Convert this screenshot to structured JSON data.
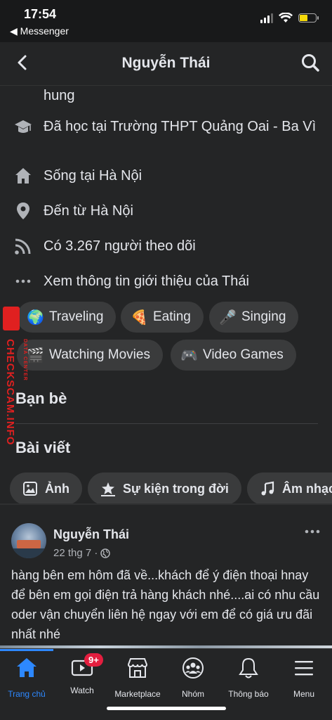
{
  "status_bar": {
    "time": "17:54",
    "back_app": "◀ Messenger"
  },
  "header": {
    "title": "Nguyễn Thái"
  },
  "intro": {
    "partial_line": "hung",
    "studied_prefix": "Đã học tại ",
    "studied_place": "Trường THPT Quảng Oai - Ba Vì",
    "lives_prefix": "Sống tại ",
    "lives_place": "Hà Nội",
    "from_prefix": "Đến từ ",
    "from_place": "Hà Nội",
    "followers": "Có 3.267 người theo dõi",
    "see_about": "Xem thông tin giới thiệu của Thái"
  },
  "hobbies": [
    {
      "label": "Traveling",
      "emoji": "🌍"
    },
    {
      "label": "Eating",
      "emoji": "🍕"
    },
    {
      "label": "Singing",
      "emoji": "🎤"
    },
    {
      "label": "Watching Movies",
      "emoji": "🎬"
    },
    {
      "label": "Video Games",
      "emoji": "🎮"
    }
  ],
  "sections": {
    "friends": "Bạn bè",
    "posts": "Bài viết"
  },
  "post_filters": [
    {
      "label": "Ảnh",
      "icon": "photo-icon"
    },
    {
      "label": "Sự kiện trong đời",
      "icon": "star-flag-icon"
    },
    {
      "label": "Âm nhạc",
      "icon": "music-note-icon"
    }
  ],
  "post": {
    "author": "Nguyễn Thái",
    "date": "22 thg 7 ·",
    "text": "hàng bên em hôm đã về...khách để ý điện thoại hnay để bên em gọi điện trả hàng khách nhé....ai có nhu cầu oder vận chuyển liên hệ ngay với em để có giá ưu đãi nhất nhé"
  },
  "watermark": {
    "text": "CHECKSCAM.INFO",
    "sub": "DATA CENTER"
  },
  "tab_bar": [
    {
      "label": "Trang chủ",
      "icon": "home-icon",
      "active": true
    },
    {
      "label": "Watch",
      "icon": "watch-video-icon",
      "badge": "9+"
    },
    {
      "label": "Marketplace",
      "icon": "marketplace-store-icon"
    },
    {
      "label": "Nhóm",
      "icon": "groups-icon"
    },
    {
      "label": "Thông báo",
      "icon": "bell-icon"
    },
    {
      "label": "Menu",
      "icon": "menu-icon"
    }
  ],
  "colors": {
    "background": "#242526",
    "accent": "#2d88ff",
    "chip": "#3a3b3c",
    "badge": "#e41e3f",
    "watermark": "#e02020"
  }
}
